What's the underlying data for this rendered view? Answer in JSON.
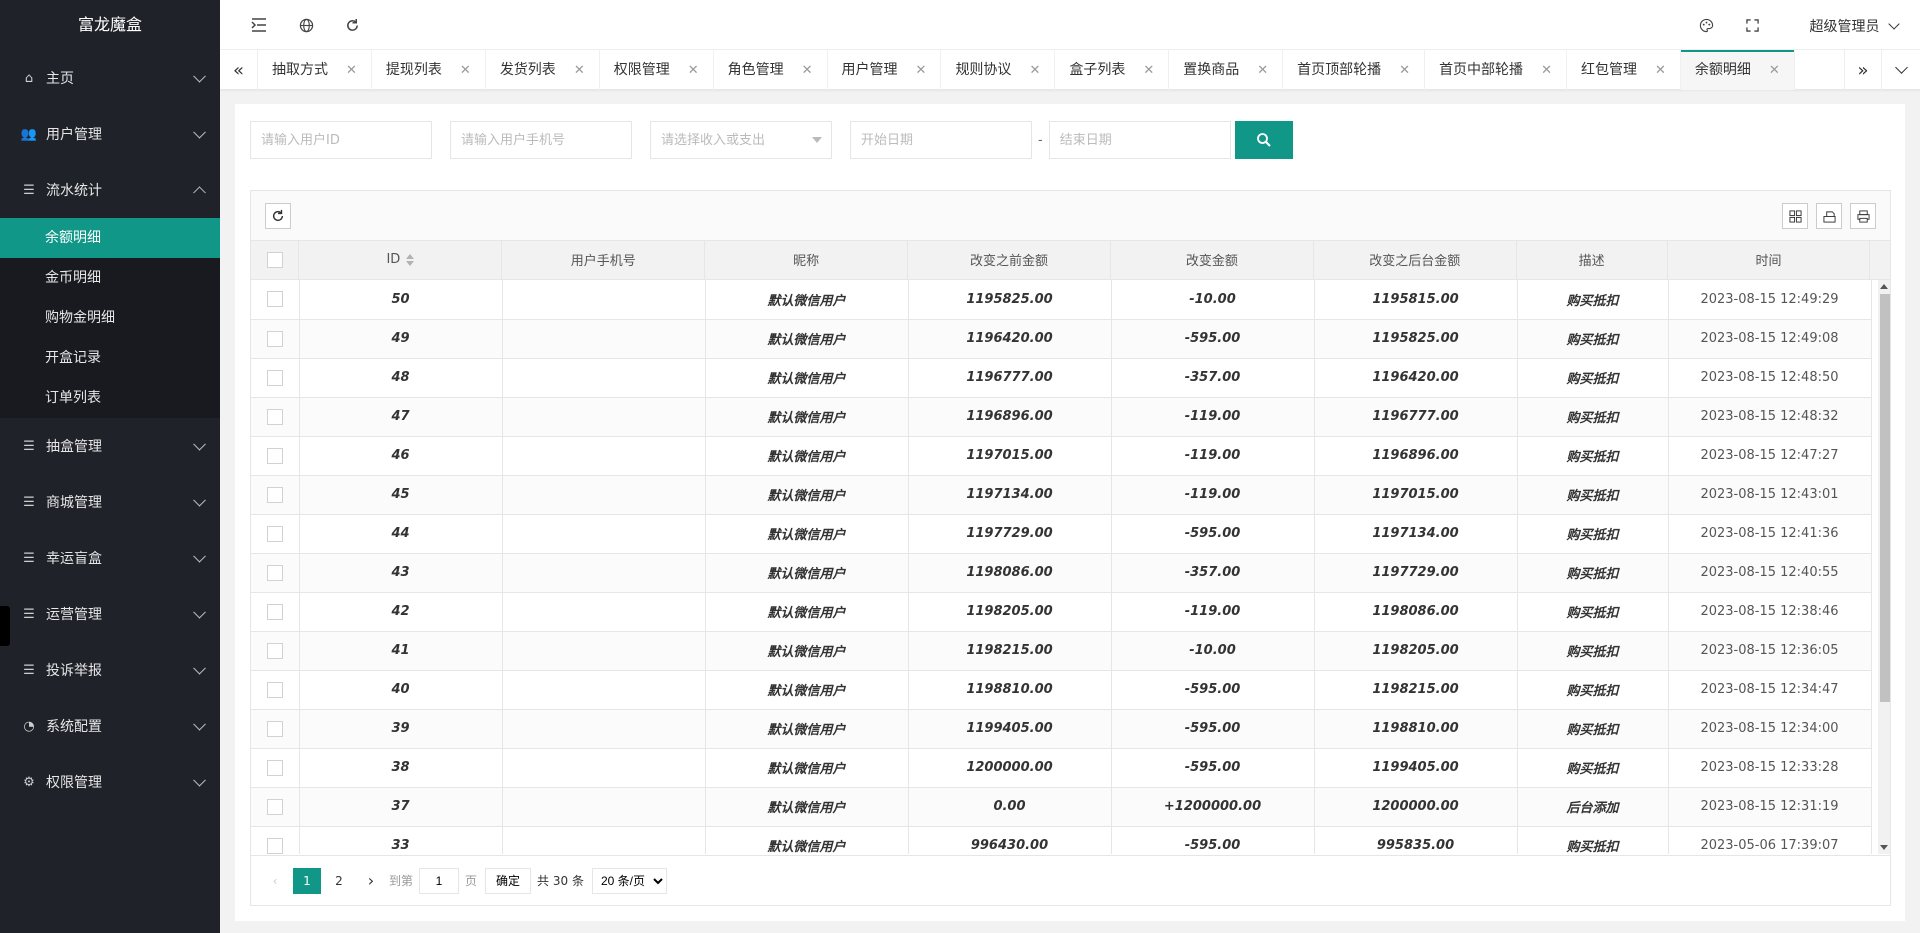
{
  "sidebar": {
    "logo": "富龙魔盒",
    "items": [
      {
        "label": "主页",
        "icon": "home-icon"
      },
      {
        "label": "用户管理",
        "icon": "users-icon"
      },
      {
        "label": "流水统计",
        "icon": "list-icon",
        "expanded": true,
        "children": [
          "余额明细",
          "金币明细",
          "购物金明细",
          "开盒记录",
          "订单列表"
        ]
      },
      {
        "label": "抽盒管理",
        "icon": "list-icon"
      },
      {
        "label": "商城管理",
        "icon": "list-icon"
      },
      {
        "label": "幸运盲盒",
        "icon": "list-icon"
      },
      {
        "label": "运营管理",
        "icon": "list-icon"
      },
      {
        "label": "投诉举报",
        "icon": "list-icon"
      },
      {
        "label": "系统配置",
        "icon": "config-icon"
      },
      {
        "label": "权限管理",
        "icon": "gear-icon"
      }
    ],
    "active_child": "余额明细"
  },
  "header": {
    "user": "超级管理员"
  },
  "tabs": [
    {
      "label": "抽取方式"
    },
    {
      "label": "提现列表"
    },
    {
      "label": "发货列表"
    },
    {
      "label": "权限管理"
    },
    {
      "label": "角色管理"
    },
    {
      "label": "用户管理"
    },
    {
      "label": "规则协议"
    },
    {
      "label": "盒子列表"
    },
    {
      "label": "置换商品"
    },
    {
      "label": "首页顶部轮播"
    },
    {
      "label": "首页中部轮播"
    },
    {
      "label": "红包管理"
    },
    {
      "label": "余额明细",
      "active": true
    }
  ],
  "filter": {
    "user_id_placeholder": "请输入用户ID",
    "phone_placeholder": "请输入用户手机号",
    "type_placeholder": "请选择收入或支出",
    "start_placeholder": "开始日期",
    "end_placeholder": "结束日期",
    "date_sep": "-"
  },
  "table": {
    "columns": [
      "ID",
      "用户手机号",
      "昵称",
      "改变之前金额",
      "改变金额",
      "改变之后台金额",
      "描述",
      "时间"
    ],
    "rows": [
      {
        "id": "50",
        "phone": "",
        "nick": "默认微信用户",
        "before": "1195825.00",
        "change": "-10.00",
        "after": "1195815.00",
        "desc": "购买抵扣",
        "time": "2023-08-15 12:49:29"
      },
      {
        "id": "49",
        "phone": "",
        "nick": "默认微信用户",
        "before": "1196420.00",
        "change": "-595.00",
        "after": "1195825.00",
        "desc": "购买抵扣",
        "time": "2023-08-15 12:49:08"
      },
      {
        "id": "48",
        "phone": "",
        "nick": "默认微信用户",
        "before": "1196777.00",
        "change": "-357.00",
        "after": "1196420.00",
        "desc": "购买抵扣",
        "time": "2023-08-15 12:48:50"
      },
      {
        "id": "47",
        "phone": "",
        "nick": "默认微信用户",
        "before": "1196896.00",
        "change": "-119.00",
        "after": "1196777.00",
        "desc": "购买抵扣",
        "time": "2023-08-15 12:48:32"
      },
      {
        "id": "46",
        "phone": "",
        "nick": "默认微信用户",
        "before": "1197015.00",
        "change": "-119.00",
        "after": "1196896.00",
        "desc": "购买抵扣",
        "time": "2023-08-15 12:47:27"
      },
      {
        "id": "45",
        "phone": "",
        "nick": "默认微信用户",
        "before": "1197134.00",
        "change": "-119.00",
        "after": "1197015.00",
        "desc": "购买抵扣",
        "time": "2023-08-15 12:43:01"
      },
      {
        "id": "44",
        "phone": "",
        "nick": "默认微信用户",
        "before": "1197729.00",
        "change": "-595.00",
        "after": "1197134.00",
        "desc": "购买抵扣",
        "time": "2023-08-15 12:41:36"
      },
      {
        "id": "43",
        "phone": "",
        "nick": "默认微信用户",
        "before": "1198086.00",
        "change": "-357.00",
        "after": "1197729.00",
        "desc": "购买抵扣",
        "time": "2023-08-15 12:40:55"
      },
      {
        "id": "42",
        "phone": "",
        "nick": "默认微信用户",
        "before": "1198205.00",
        "change": "-119.00",
        "after": "1198086.00",
        "desc": "购买抵扣",
        "time": "2023-08-15 12:38:46"
      },
      {
        "id": "41",
        "phone": "",
        "nick": "默认微信用户",
        "before": "1198215.00",
        "change": "-10.00",
        "after": "1198205.00",
        "desc": "购买抵扣",
        "time": "2023-08-15 12:36:05"
      },
      {
        "id": "40",
        "phone": "",
        "nick": "默认微信用户",
        "before": "1198810.00",
        "change": "-595.00",
        "after": "1198215.00",
        "desc": "购买抵扣",
        "time": "2023-08-15 12:34:47"
      },
      {
        "id": "39",
        "phone": "",
        "nick": "默认微信用户",
        "before": "1199405.00",
        "change": "-595.00",
        "after": "1198810.00",
        "desc": "购买抵扣",
        "time": "2023-08-15 12:34:00"
      },
      {
        "id": "38",
        "phone": "",
        "nick": "默认微信用户",
        "before": "1200000.00",
        "change": "-595.00",
        "after": "1199405.00",
        "desc": "购买抵扣",
        "time": "2023-08-15 12:33:28"
      },
      {
        "id": "37",
        "phone": "",
        "nick": "默认微信用户",
        "before": "0.00",
        "change": "+1200000.00",
        "after": "1200000.00",
        "desc": "后台添加",
        "time": "2023-08-15 12:31:19"
      },
      {
        "id": "33",
        "phone": "",
        "nick": "默认微信用户",
        "before": "996430.00",
        "change": "-595.00",
        "after": "995835.00",
        "desc": "购买抵扣",
        "time": "2023-05-06 17:39:07"
      }
    ]
  },
  "pager": {
    "pages": [
      "1",
      "2"
    ],
    "current": "1",
    "goto_label": "到第",
    "goto_value": "1",
    "page_unit": "页",
    "ok_label": "确定",
    "total": "共 30 条",
    "per_page": "20 条/页"
  },
  "colors": {
    "accent": "#119788",
    "sidebar": "#20222a"
  }
}
